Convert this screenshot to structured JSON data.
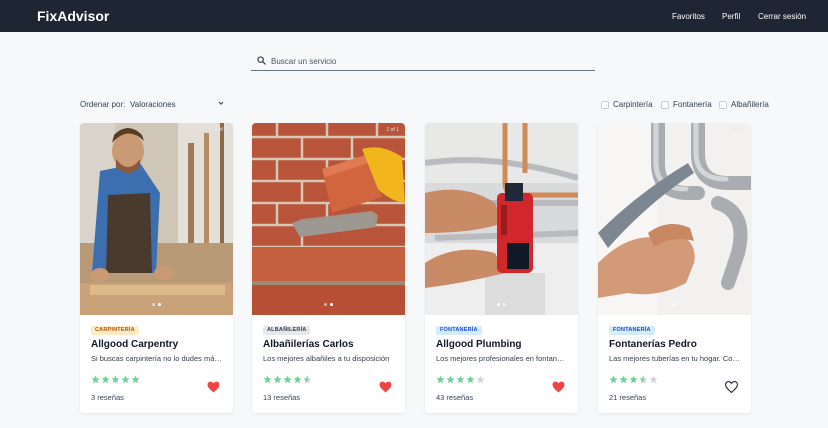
{
  "nav": {
    "brand": "FixAdvisor",
    "favoritos": "Favoritos",
    "perfil": "Perfil",
    "logout": "Cerrar sesión"
  },
  "search": {
    "placeholder": "Buscar un servicio",
    "value": ""
  },
  "sort": {
    "label": "Ordenar por:",
    "value": "Valoraciones"
  },
  "filters": [
    "Carpintería",
    "Fontanería",
    "Albañilería"
  ],
  "colors": {
    "navbar": "#1e2633",
    "star": "#6fcf97",
    "heart": "#ef4444"
  },
  "cards": [
    {
      "badge": "CARPINTERÍA",
      "title": "Allgood Carpentry",
      "desc": "Si buscas carpintería no lo dudes más, somos los mejores",
      "rating": 5,
      "reviews": "3 reseñas",
      "favorite": true,
      "counter": "1 of 1",
      "dots": 2,
      "active_dot": 1,
      "image": "carpenter-photo"
    },
    {
      "badge": "ALBAÑILERÍA",
      "title": "Albañilerías Carlos",
      "desc": "Los mejores albañiles a tu disposición",
      "rating": 4.5,
      "reviews": "13 reseñas",
      "favorite": true,
      "counter": "1 of 1",
      "dots": 2,
      "active_dot": 1,
      "image": "bricklayer-photo"
    },
    {
      "badge": "FONTANERÍA",
      "title": "Allgood Plumbing",
      "desc": "Los mejores profesionales en fontanería",
      "rating": 4,
      "reviews": "43 reseñas",
      "favorite": true,
      "counter": "1 of 1",
      "dots": 2,
      "active_dot": 0,
      "image": "plumber-photo"
    },
    {
      "badge": "FONTANERÍA",
      "title": "Fontanerías Pedro",
      "desc": "Las mejores tuberías en tu hogar. Contáctanos",
      "rating": 3.5,
      "reviews": "21 reseñas",
      "favorite": false,
      "counter": "1 of 1",
      "dots": 1,
      "active_dot": 0,
      "image": "pipes-photo"
    }
  ]
}
